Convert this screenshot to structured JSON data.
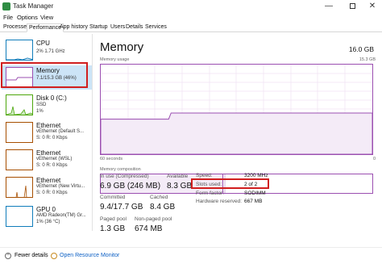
{
  "window": {
    "title": "Task Manager",
    "minimize_glyph": "—",
    "close_glyph": "✕"
  },
  "menu": [
    "File",
    "Options",
    "View"
  ],
  "tabs": [
    "Processes",
    "Performance",
    "App history",
    "Startup",
    "Users",
    "Details",
    "Services"
  ],
  "sidebar": {
    "items": [
      {
        "name": "CPU",
        "sub1": "2%  1.71 GHz",
        "sub2": ""
      },
      {
        "name": "Memory",
        "sub1": "7.1/15.3 GB (46%)",
        "sub2": ""
      },
      {
        "name": "Disk 0 (C:)",
        "sub1": "SSD",
        "sub2": "1%"
      },
      {
        "name": "Ethernet",
        "sub1": "vEthernet (Default S...",
        "sub2": "S: 0  R: 0 Kbps"
      },
      {
        "name": "Ethernet",
        "sub1": "vEthernet (WSL)",
        "sub2": "S: 0  R: 0 Kbps"
      },
      {
        "name": "Ethernet",
        "sub1": "vEthernet (New Virtu...",
        "sub2": "S: 0  R: 0 Kbps"
      },
      {
        "name": "GPU 0",
        "sub1": "AMD Radeon(TM) Gr...",
        "sub2": "1% (36 °C)"
      }
    ]
  },
  "main": {
    "title": "Memory",
    "total": "16.0 GB",
    "usage_label": "Memory usage",
    "usage_max": "15.3 GB",
    "time_left": "60 seconds",
    "time_right": "0",
    "composition_label": "Memory composition",
    "usage_level": 0.46,
    "stats": {
      "in_use_label": "In use (Compressed)",
      "in_use_value": "6.9 GB (246 MB)",
      "available_label": "Available",
      "available_value": "8.3 GB",
      "committed_label": "Committed",
      "committed_value": "9.4/17.7 GB",
      "cached_label": "Cached",
      "cached_value": "8.4 GB",
      "paged_label": "Paged pool",
      "paged_value": "1.3 GB",
      "nonpaged_label": "Non-paged pool",
      "nonpaged_value": "674 MB"
    },
    "details": {
      "speed_label": "Speed:",
      "speed_value": "3200 MHz",
      "slots_label": "Slots used:",
      "slots_value": "2 of 2",
      "form_label": "Form factor:",
      "form_value": "SODIMM",
      "hw_label": "Hardware reserved:",
      "hw_value": "667 MB"
    }
  },
  "footer": {
    "fewer_details": "Fewer details",
    "separator": "|",
    "open_monitor": "Open Resource Monitor"
  },
  "colors": {
    "memory_accent": "#9b4fb1",
    "cpu_accent": "#117dbb",
    "disk_accent": "#4da60c",
    "ethernet_accent": "#a74f01",
    "highlight": "#d11f1f"
  }
}
